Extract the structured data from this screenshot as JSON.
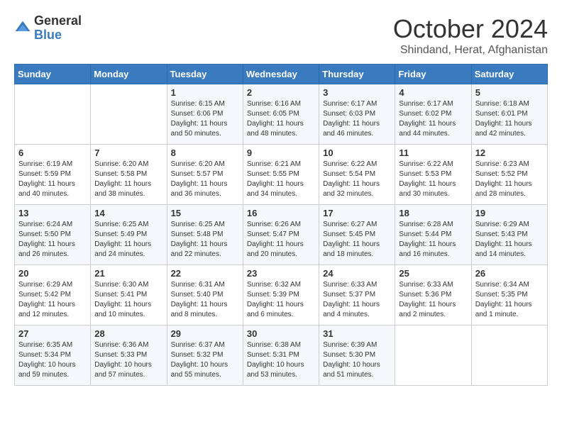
{
  "logo": {
    "general": "General",
    "blue": "Blue"
  },
  "title": "October 2024",
  "location": "Shindand, Herat, Afghanistan",
  "days_of_week": [
    "Sunday",
    "Monday",
    "Tuesday",
    "Wednesday",
    "Thursday",
    "Friday",
    "Saturday"
  ],
  "weeks": [
    [
      {
        "day": "",
        "sunrise": "",
        "sunset": "",
        "daylight": ""
      },
      {
        "day": "",
        "sunrise": "",
        "sunset": "",
        "daylight": ""
      },
      {
        "day": "1",
        "sunrise": "Sunrise: 6:15 AM",
        "sunset": "Sunset: 6:06 PM",
        "daylight": "Daylight: 11 hours and 50 minutes."
      },
      {
        "day": "2",
        "sunrise": "Sunrise: 6:16 AM",
        "sunset": "Sunset: 6:05 PM",
        "daylight": "Daylight: 11 hours and 48 minutes."
      },
      {
        "day": "3",
        "sunrise": "Sunrise: 6:17 AM",
        "sunset": "Sunset: 6:03 PM",
        "daylight": "Daylight: 11 hours and 46 minutes."
      },
      {
        "day": "4",
        "sunrise": "Sunrise: 6:17 AM",
        "sunset": "Sunset: 6:02 PM",
        "daylight": "Daylight: 11 hours and 44 minutes."
      },
      {
        "day": "5",
        "sunrise": "Sunrise: 6:18 AM",
        "sunset": "Sunset: 6:01 PM",
        "daylight": "Daylight: 11 hours and 42 minutes."
      }
    ],
    [
      {
        "day": "6",
        "sunrise": "Sunrise: 6:19 AM",
        "sunset": "Sunset: 5:59 PM",
        "daylight": "Daylight: 11 hours and 40 minutes."
      },
      {
        "day": "7",
        "sunrise": "Sunrise: 6:20 AM",
        "sunset": "Sunset: 5:58 PM",
        "daylight": "Daylight: 11 hours and 38 minutes."
      },
      {
        "day": "8",
        "sunrise": "Sunrise: 6:20 AM",
        "sunset": "Sunset: 5:57 PM",
        "daylight": "Daylight: 11 hours and 36 minutes."
      },
      {
        "day": "9",
        "sunrise": "Sunrise: 6:21 AM",
        "sunset": "Sunset: 5:55 PM",
        "daylight": "Daylight: 11 hours and 34 minutes."
      },
      {
        "day": "10",
        "sunrise": "Sunrise: 6:22 AM",
        "sunset": "Sunset: 5:54 PM",
        "daylight": "Daylight: 11 hours and 32 minutes."
      },
      {
        "day": "11",
        "sunrise": "Sunrise: 6:22 AM",
        "sunset": "Sunset: 5:53 PM",
        "daylight": "Daylight: 11 hours and 30 minutes."
      },
      {
        "day": "12",
        "sunrise": "Sunrise: 6:23 AM",
        "sunset": "Sunset: 5:52 PM",
        "daylight": "Daylight: 11 hours and 28 minutes."
      }
    ],
    [
      {
        "day": "13",
        "sunrise": "Sunrise: 6:24 AM",
        "sunset": "Sunset: 5:50 PM",
        "daylight": "Daylight: 11 hours and 26 minutes."
      },
      {
        "day": "14",
        "sunrise": "Sunrise: 6:25 AM",
        "sunset": "Sunset: 5:49 PM",
        "daylight": "Daylight: 11 hours and 24 minutes."
      },
      {
        "day": "15",
        "sunrise": "Sunrise: 6:25 AM",
        "sunset": "Sunset: 5:48 PM",
        "daylight": "Daylight: 11 hours and 22 minutes."
      },
      {
        "day": "16",
        "sunrise": "Sunrise: 6:26 AM",
        "sunset": "Sunset: 5:47 PM",
        "daylight": "Daylight: 11 hours and 20 minutes."
      },
      {
        "day": "17",
        "sunrise": "Sunrise: 6:27 AM",
        "sunset": "Sunset: 5:45 PM",
        "daylight": "Daylight: 11 hours and 18 minutes."
      },
      {
        "day": "18",
        "sunrise": "Sunrise: 6:28 AM",
        "sunset": "Sunset: 5:44 PM",
        "daylight": "Daylight: 11 hours and 16 minutes."
      },
      {
        "day": "19",
        "sunrise": "Sunrise: 6:29 AM",
        "sunset": "Sunset: 5:43 PM",
        "daylight": "Daylight: 11 hours and 14 minutes."
      }
    ],
    [
      {
        "day": "20",
        "sunrise": "Sunrise: 6:29 AM",
        "sunset": "Sunset: 5:42 PM",
        "daylight": "Daylight: 11 hours and 12 minutes."
      },
      {
        "day": "21",
        "sunrise": "Sunrise: 6:30 AM",
        "sunset": "Sunset: 5:41 PM",
        "daylight": "Daylight: 11 hours and 10 minutes."
      },
      {
        "day": "22",
        "sunrise": "Sunrise: 6:31 AM",
        "sunset": "Sunset: 5:40 PM",
        "daylight": "Daylight: 11 hours and 8 minutes."
      },
      {
        "day": "23",
        "sunrise": "Sunrise: 6:32 AM",
        "sunset": "Sunset: 5:39 PM",
        "daylight": "Daylight: 11 hours and 6 minutes."
      },
      {
        "day": "24",
        "sunrise": "Sunrise: 6:33 AM",
        "sunset": "Sunset: 5:37 PM",
        "daylight": "Daylight: 11 hours and 4 minutes."
      },
      {
        "day": "25",
        "sunrise": "Sunrise: 6:33 AM",
        "sunset": "Sunset: 5:36 PM",
        "daylight": "Daylight: 11 hours and 2 minutes."
      },
      {
        "day": "26",
        "sunrise": "Sunrise: 6:34 AM",
        "sunset": "Sunset: 5:35 PM",
        "daylight": "Daylight: 11 hours and 1 minute."
      }
    ],
    [
      {
        "day": "27",
        "sunrise": "Sunrise: 6:35 AM",
        "sunset": "Sunset: 5:34 PM",
        "daylight": "Daylight: 10 hours and 59 minutes."
      },
      {
        "day": "28",
        "sunrise": "Sunrise: 6:36 AM",
        "sunset": "Sunset: 5:33 PM",
        "daylight": "Daylight: 10 hours and 57 minutes."
      },
      {
        "day": "29",
        "sunrise": "Sunrise: 6:37 AM",
        "sunset": "Sunset: 5:32 PM",
        "daylight": "Daylight: 10 hours and 55 minutes."
      },
      {
        "day": "30",
        "sunrise": "Sunrise: 6:38 AM",
        "sunset": "Sunset: 5:31 PM",
        "daylight": "Daylight: 10 hours and 53 minutes."
      },
      {
        "day": "31",
        "sunrise": "Sunrise: 6:39 AM",
        "sunset": "Sunset: 5:30 PM",
        "daylight": "Daylight: 10 hours and 51 minutes."
      },
      {
        "day": "",
        "sunrise": "",
        "sunset": "",
        "daylight": ""
      },
      {
        "day": "",
        "sunrise": "",
        "sunset": "",
        "daylight": ""
      }
    ]
  ]
}
